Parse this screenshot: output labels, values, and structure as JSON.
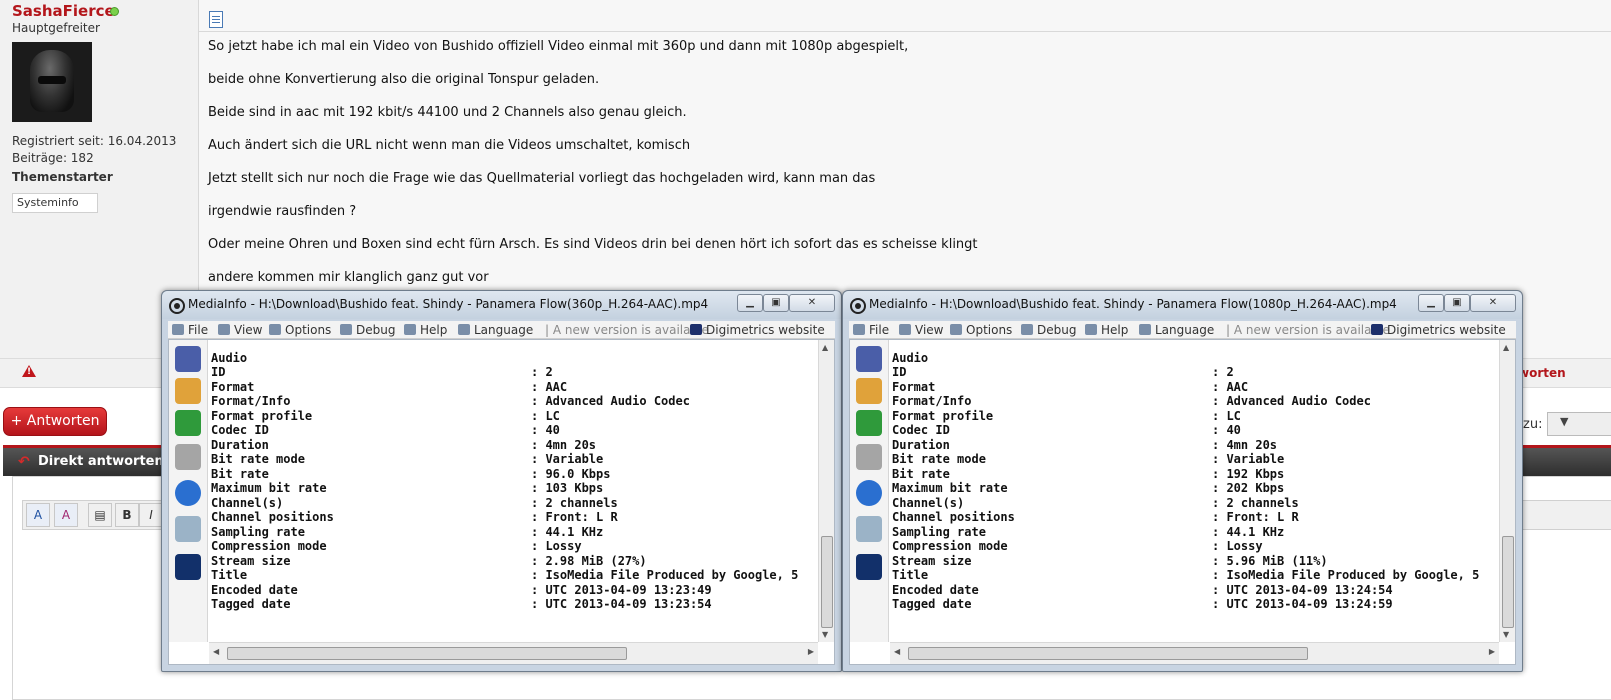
{
  "user": {
    "name": "SashaFierce",
    "rank": "Hauptgefreiter",
    "registered": "Registriert seit: 16.04.2013",
    "posts": "Beiträge: 182",
    "starter": "Themenstarter",
    "sysinfo": "Systeminfo"
  },
  "post": {
    "lines": [
      "So jetzt habe ich mal ein Video von Bushido offiziell Video einmal mit 360p und dann mit 1080p abgespielt,",
      "beide ohne Konvertierung also die original Tonspur geladen.",
      "Beide sind in aac mit 192 kbit/s 44100 und 2 Channels also genau gleich.",
      "Auch ändert sich die URL nicht wenn man die Videos umschaltet, komisch",
      "Jetzt stellt sich nur noch die Frage wie das Quellmaterial vorliegt das hochgeladen wird, kann man das",
      "irgendwie rausfinden ?",
      "Oder meine Ohren und Boxen sind echt fürn Arsch. Es sind Videos drin bei denen hört ich sofort das es scheisse klingt",
      "andere kommen mir klanglich ganz gut vor"
    ]
  },
  "footer": {
    "answer_btn": "Antworten",
    "reply_bar": "Direkt antworten",
    "right_action": "worten",
    "right_zu": "zu:"
  },
  "mediainfo": {
    "menu": [
      "File",
      "View",
      "Options",
      "Debug",
      "Help",
      "Language"
    ],
    "version_note": "| A new version is available",
    "website": "Digimetrics website",
    "windows": [
      {
        "title": "MediaInfo - H:\\Download\\Bushido feat. Shindy - Panamera Flow(360p_H.264-AAC).mp4",
        "rows": [
          {
            "k": "Audio",
            "v": ""
          },
          {
            "k": "ID",
            "v": ": 2"
          },
          {
            "k": "Format",
            "v": ": AAC"
          },
          {
            "k": "Format/Info",
            "v": ": Advanced Audio Codec"
          },
          {
            "k": "Format profile",
            "v": ": LC"
          },
          {
            "k": "Codec ID",
            "v": ": 40"
          },
          {
            "k": "Duration",
            "v": ": 4mn 20s"
          },
          {
            "k": "Bit rate mode",
            "v": ": Variable"
          },
          {
            "k": "Bit rate",
            "v": ": 96.0 Kbps"
          },
          {
            "k": "Maximum bit rate",
            "v": ": 103 Kbps"
          },
          {
            "k": "Channel(s)",
            "v": ": 2 channels"
          },
          {
            "k": "Channel positions",
            "v": ": Front: L R"
          },
          {
            "k": "Sampling rate",
            "v": ": 44.1 KHz"
          },
          {
            "k": "Compression mode",
            "v": ": Lossy"
          },
          {
            "k": "Stream size",
            "v": ": 2.98 MiB (27%)"
          },
          {
            "k": "Title",
            "v": ": IsoMedia File Produced by Google, 5"
          },
          {
            "k": "Encoded date",
            "v": ": UTC 2013-04-09 13:23:49"
          },
          {
            "k": "Tagged date",
            "v": ": UTC 2013-04-09 13:23:54"
          }
        ]
      },
      {
        "title": "MediaInfo - H:\\Download\\Bushido feat. Shindy - Panamera Flow(1080p_H.264-AAC).mp4",
        "rows": [
          {
            "k": "Audio",
            "v": ""
          },
          {
            "k": "ID",
            "v": ": 2"
          },
          {
            "k": "Format",
            "v": ": AAC"
          },
          {
            "k": "Format/Info",
            "v": ": Advanced Audio Codec"
          },
          {
            "k": "Format profile",
            "v": ": LC"
          },
          {
            "k": "Codec ID",
            "v": ": 40"
          },
          {
            "k": "Duration",
            "v": ": 4mn 20s"
          },
          {
            "k": "Bit rate mode",
            "v": ": Variable"
          },
          {
            "k": "Bit rate",
            "v": ": 192 Kbps"
          },
          {
            "k": "Maximum bit rate",
            "v": ": 202 Kbps"
          },
          {
            "k": "Channel(s)",
            "v": ": 2 channels"
          },
          {
            "k": "Channel positions",
            "v": ": Front: L R"
          },
          {
            "k": "Sampling rate",
            "v": ": 44.1 KHz"
          },
          {
            "k": "Compression mode",
            "v": ": Lossy"
          },
          {
            "k": "Stream size",
            "v": ": 5.96 MiB (11%)"
          },
          {
            "k": "Title",
            "v": ": IsoMedia File Produced by Google, 5"
          },
          {
            "k": "Encoded date",
            "v": ": UTC 2013-04-09 13:24:54"
          },
          {
            "k": "Tagged date",
            "v": ": UTC 2013-04-09 13:24:59"
          }
        ]
      }
    ]
  },
  "colors": {
    "accent_red": "#b3161b",
    "online_green": "#7bd14b"
  }
}
